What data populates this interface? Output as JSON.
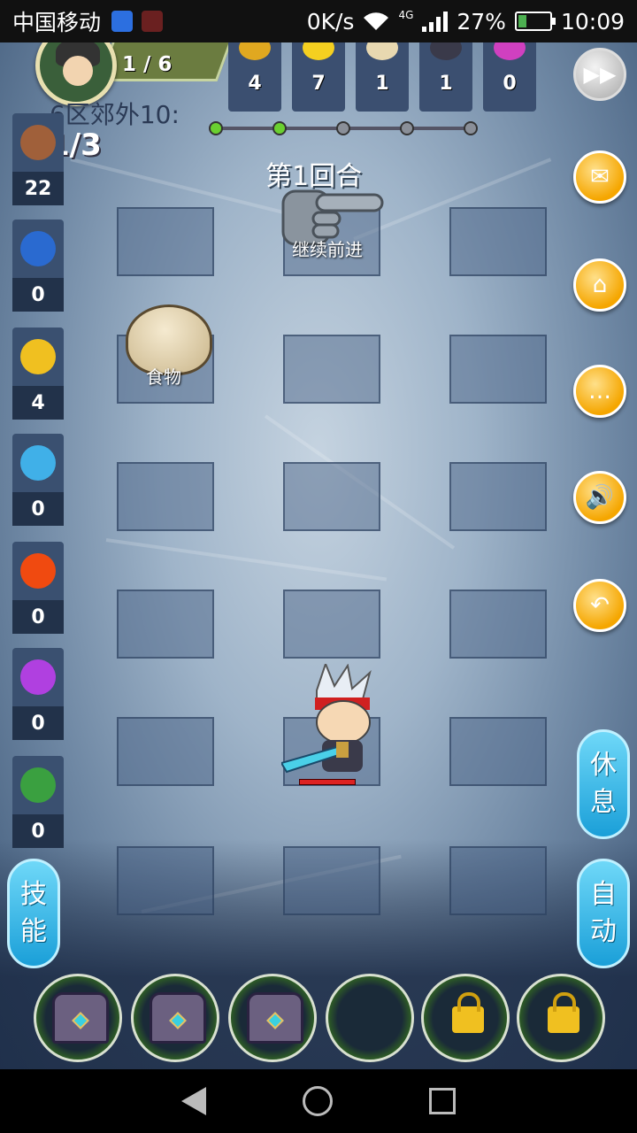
{
  "status_bar": {
    "carrier": "中国移动",
    "network_speed": "0K/s",
    "network_type": "4G",
    "battery": "27%",
    "battery_level": 0.27,
    "time": "10:09"
  },
  "player": {
    "level_progress": "1 / 6"
  },
  "resources": [
    {
      "name": "gold-coin-icon",
      "value": "4",
      "color": "#e0a820"
    },
    {
      "name": "lightning-icon",
      "value": "7",
      "color": "#f5d020"
    },
    {
      "name": "bun-icon",
      "value": "1",
      "color": "#e8d8b0"
    },
    {
      "name": "ore-icon",
      "value": "1",
      "color": "#3a3a4a"
    },
    {
      "name": "crystal-icon",
      "value": "0",
      "color": "#d040c0"
    }
  ],
  "stage": {
    "title": "6区郊外10:",
    "wave": "1/3",
    "round": "第1回合",
    "progress_total": 5,
    "progress_done": 2
  },
  "skills": [
    {
      "name": "fist-icon",
      "count": "22",
      "color": "#a0603a"
    },
    {
      "name": "shield-icon",
      "count": "0",
      "color": "#2a6ad0"
    },
    {
      "name": "fire-arrow-icon",
      "count": "4",
      "color": "#f0c020"
    },
    {
      "name": "wave-icon",
      "count": "0",
      "color": "#40b0e8"
    },
    {
      "name": "fireball-icon",
      "count": "0",
      "color": "#f04a10"
    },
    {
      "name": "lightning-rune-icon",
      "count": "0",
      "color": "#b040e0"
    },
    {
      "name": "poison-icon",
      "count": "0",
      "color": "#3aa040"
    }
  ],
  "board": {
    "continue_label": "继续前进",
    "food_label": "食物"
  },
  "right_buttons": {
    "rest": "休息",
    "auto": "自动"
  },
  "left_buttons": {
    "skill": "技能"
  },
  "colors": {
    "accent": "#f5a600",
    "pill": "#1a9fd8"
  }
}
